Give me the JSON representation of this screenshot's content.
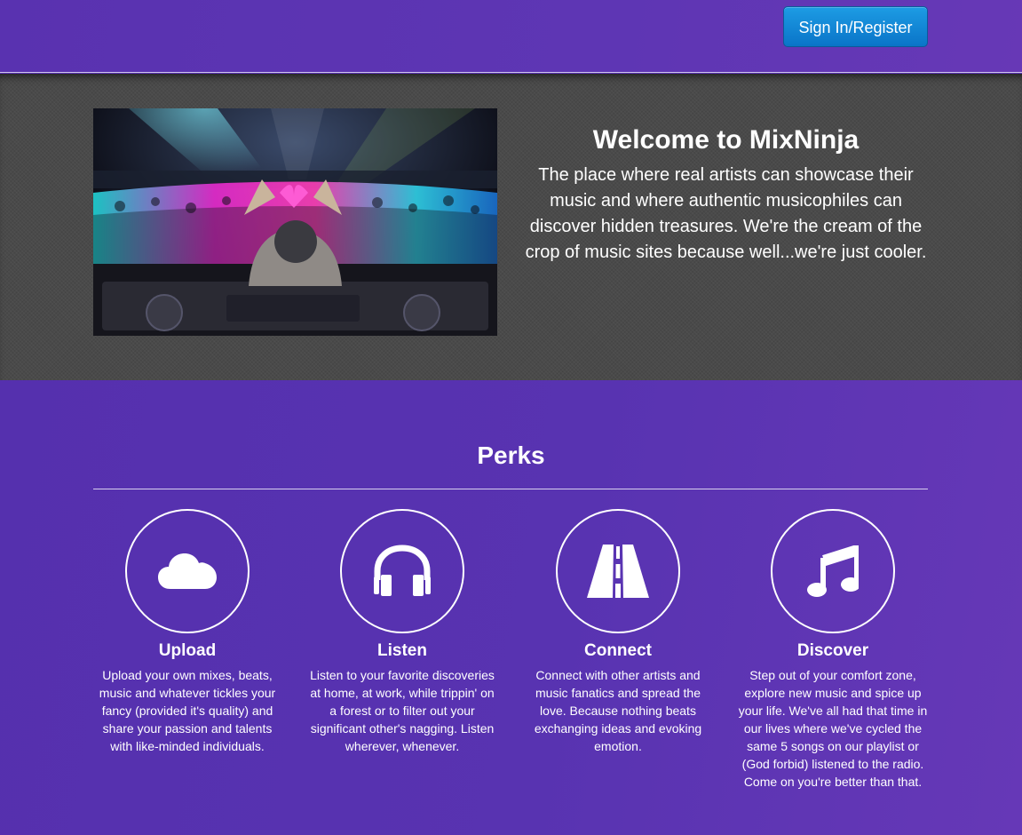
{
  "header": {
    "signin_label": "Sign In/Register"
  },
  "hero": {
    "title": "Welcome to MixNinja",
    "description": "The place where real artists can showcase their music and where authentic musicophiles can discover hidden treasures. We're the cream of the crop of music sites because well...we're just cooler."
  },
  "perks": {
    "title": "Perks",
    "items": [
      {
        "icon": "cloud-icon",
        "title": "Upload",
        "description": "Upload your own mixes, beats, music and whatever tickles your fancy (provided it's quality) and share your passion and talents with like-minded individuals."
      },
      {
        "icon": "headphones-icon",
        "title": "Listen",
        "description": "Listen to your favorite discoveries at home, at work, while trippin' on a forest or to filter out your significant other's nagging. Listen wherever, whenever."
      },
      {
        "icon": "road-icon",
        "title": "Connect",
        "description": "Connect with other artists and music fanatics and spread the love. Because nothing beats exchanging ideas and evoking emotion."
      },
      {
        "icon": "music-note-icon",
        "title": "Discover",
        "description": "Step out of your comfort zone, explore new music and spice up your life. We've all had that time in our lives where we've cycled the same 5 songs on our playlist or (God forbid) listened to the radio. Come on you're better than that."
      }
    ]
  },
  "colors": {
    "primary_purple": "#5a35b0",
    "hero_gray": "#4a4a4a",
    "button_blue": "#0a74c8"
  }
}
